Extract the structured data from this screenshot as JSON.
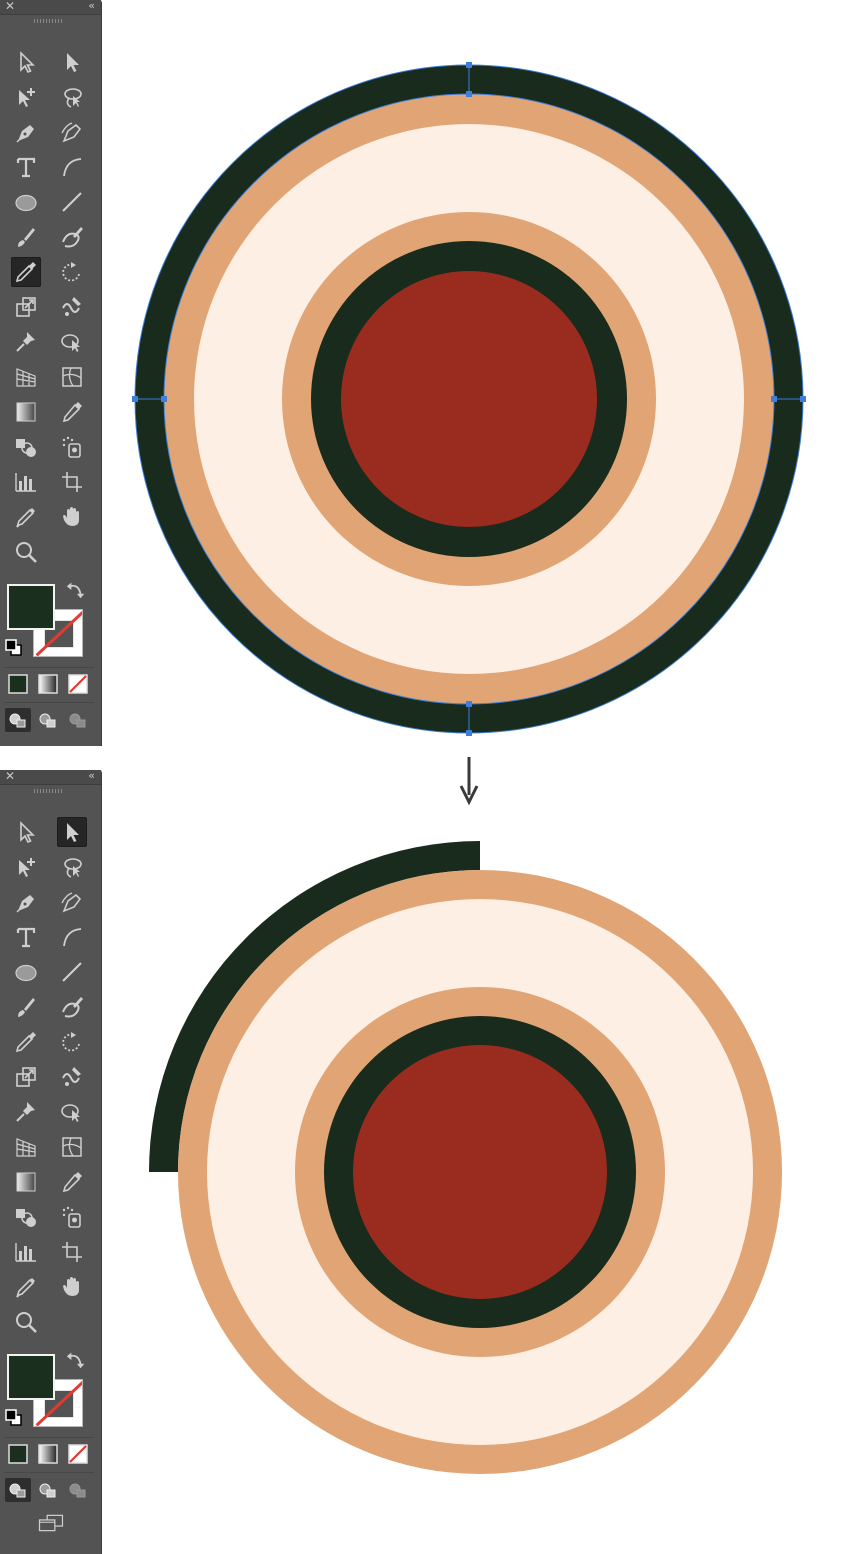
{
  "app": {
    "toolbar_panel": {
      "close_label": "✕",
      "collapse_label": "‹‹",
      "tools": [
        "selection-tool",
        "direct-selection-tool",
        "add-anchor-point-tool",
        "lasso-tool",
        "pen-tool",
        "curvature-tool",
        "type-tool",
        "arc-tool",
        "ellipse-tool",
        "line-segment-tool",
        "paintbrush-tool",
        "blob-brush-tool",
        "eyedropper-tool",
        "rotate-tool",
        "scale-tool",
        "warp-tool",
        "pin-tool",
        "shape-builder-tool",
        "perspective-grid-tool",
        "mesh-tool",
        "gradient-tool",
        "eyedropper-sample-tool",
        "blend-tool",
        "symbol-sprayer-tool",
        "column-graph-tool",
        "artboard-tool",
        "eraser-pencil-tool",
        "hand-tool",
        "zoom-tool"
      ],
      "selected_tool_top": "eyedropper-tool",
      "selected_tool_bottom": "direct-selection-tool",
      "fill_color": "#1b2f1f",
      "stroke_color": "none",
      "color_modes": [
        "color",
        "gradient",
        "none"
      ],
      "draw_modes": [
        "draw-normal",
        "draw-behind",
        "draw-inside"
      ]
    }
  },
  "canvas": {
    "colors": {
      "dark_green": "#182b1d",
      "orange": "#e1a475",
      "cream": "#fdefe4",
      "red": "#992c1e",
      "selection_blue": "#3d7fd9",
      "arrow_gray": "#3a3a3a"
    },
    "top_figure": {
      "state": "selected",
      "rings_outer_to_inner": [
        "dark_green",
        "orange",
        "cream",
        "orange",
        "dark_green",
        "red"
      ]
    },
    "bottom_figure": {
      "state": "outer ring cut to quarter arc",
      "rings_outer_to_inner": [
        "dark_green_arc",
        "orange",
        "cream",
        "orange",
        "dark_green",
        "red"
      ]
    }
  }
}
